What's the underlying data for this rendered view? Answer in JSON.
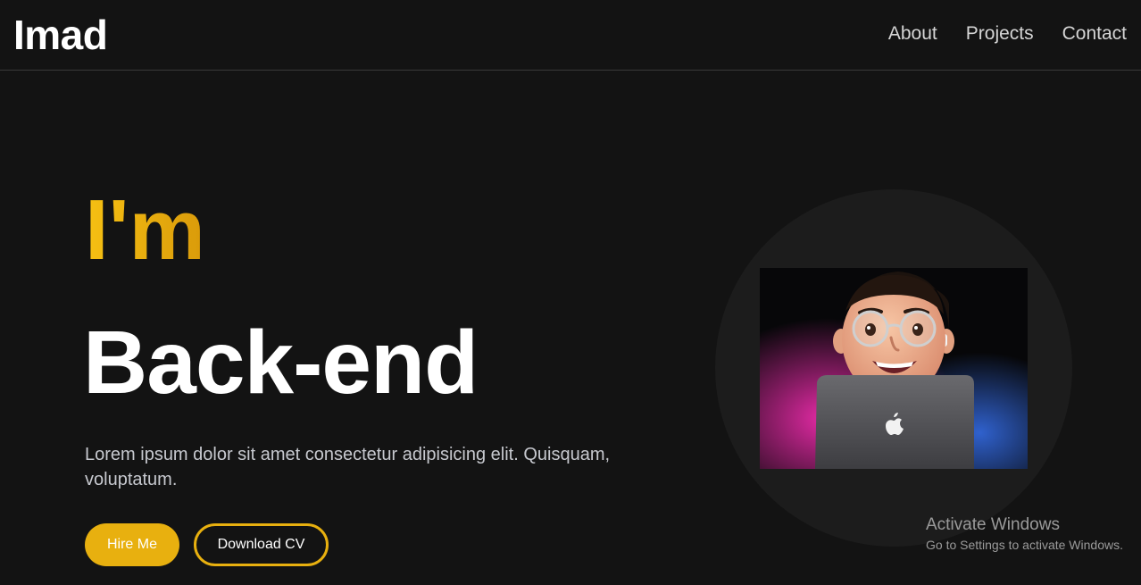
{
  "header": {
    "logo": "Imad",
    "nav": [
      "About",
      "Projects",
      "Contact"
    ]
  },
  "hero": {
    "prefix": "I'm",
    "title": "Back-end",
    "description": "Lorem ipsum dolor sit amet consectetur adipisicing elit. Quisquam, voluptatum.",
    "buttons": {
      "primary": "Hire Me",
      "secondary": "Download CV"
    },
    "image_icon": "memoji-with-laptop-illustration"
  },
  "overlay": {
    "title": "Activate Windows",
    "subtitle": "Go to Settings to activate Windows."
  },
  "colors": {
    "background": "#131313",
    "accent": "#e8b00f",
    "text": "#ffffff",
    "muted": "#c7c9cf"
  }
}
